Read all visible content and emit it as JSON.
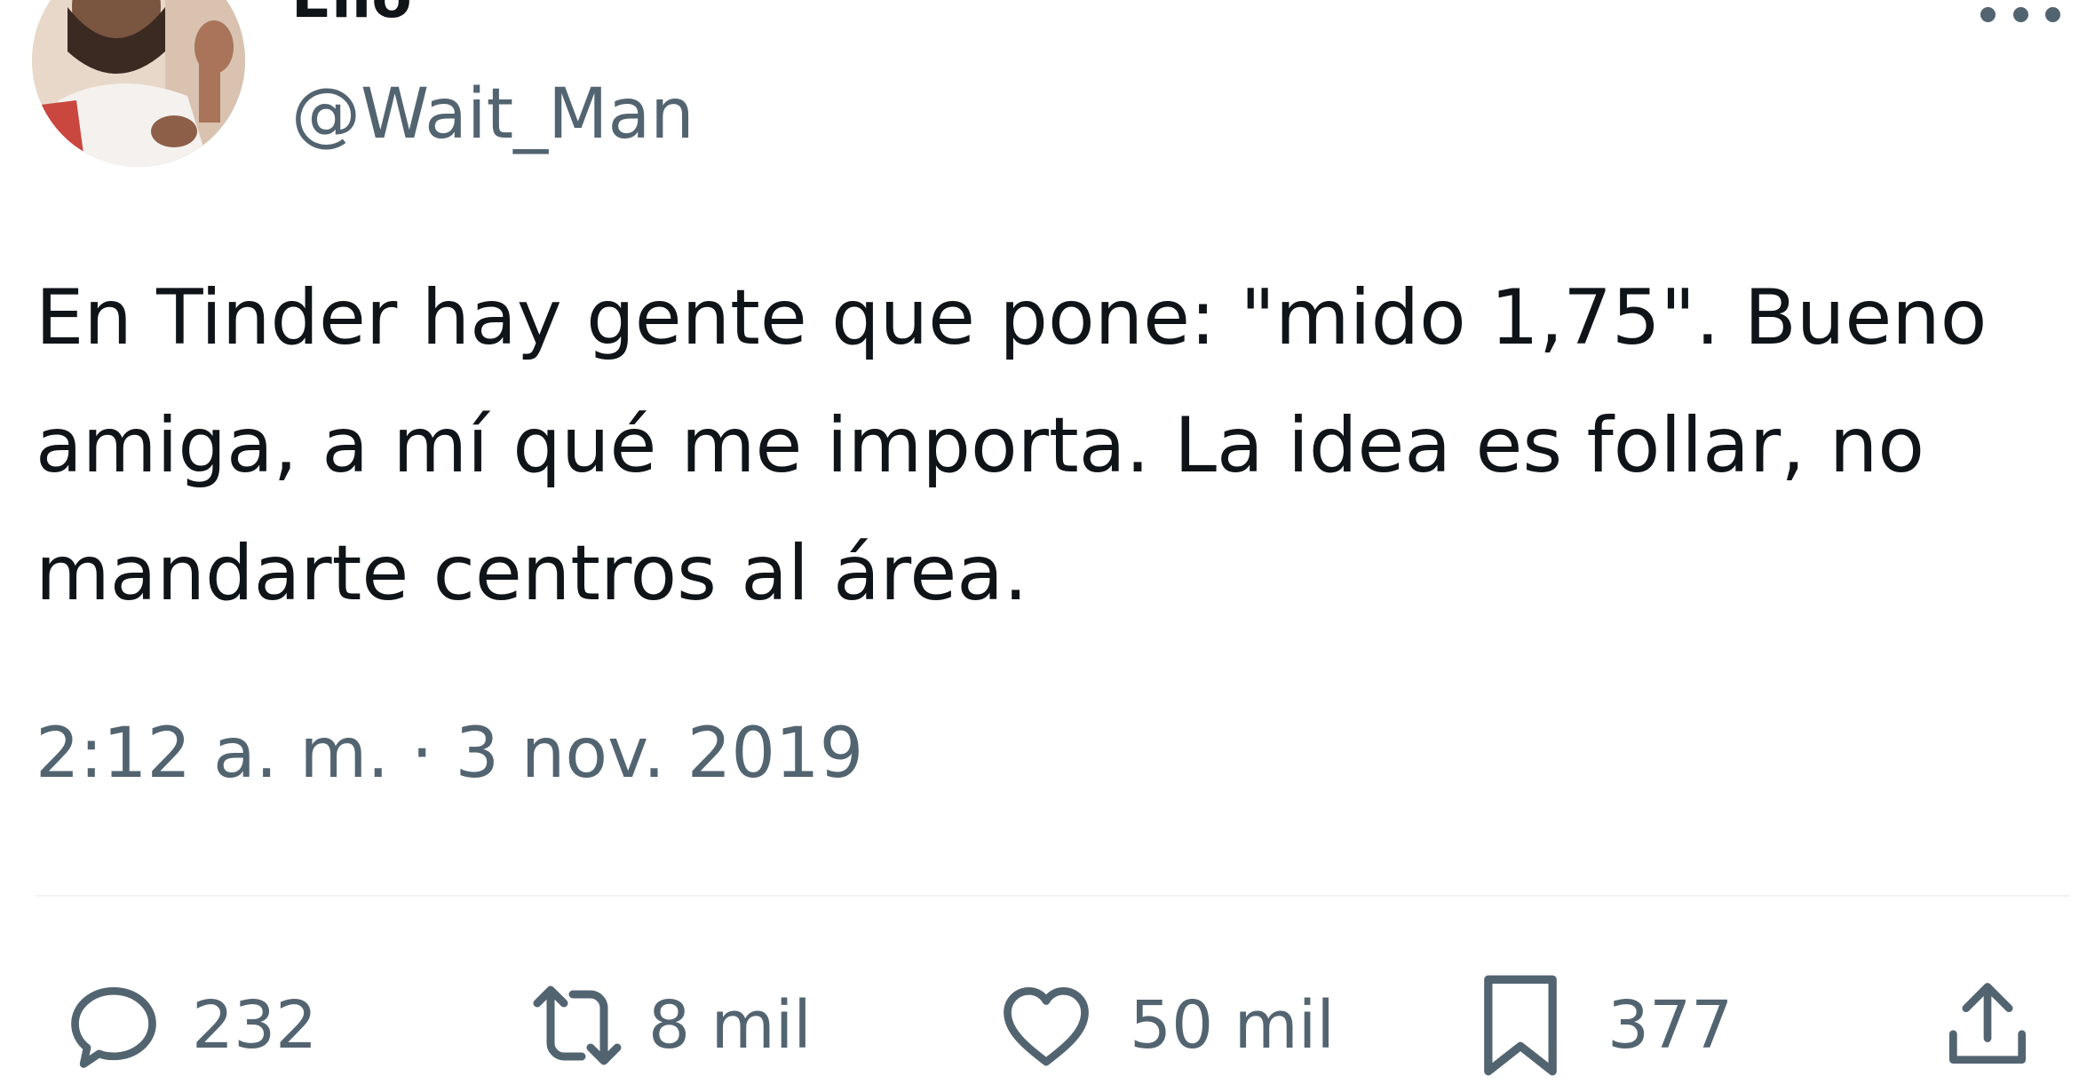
{
  "author": {
    "display_name": "Ello",
    "handle": "@Wait_Man",
    "avatar_icon": "profile-photo"
  },
  "tweet": {
    "text": "En Tinder hay gente que pone: \"mido 1,75\". Bueno amiga, a mí qué me importa. La idea es follar, no mandarte centros al área.",
    "timestamp": "2:12 a. m. · 3 nov. 2019"
  },
  "actions": {
    "reply_count": "232",
    "retweet_count": "8 mil",
    "like_count": "50 mil",
    "bookmark_count": "377",
    "icons": [
      "reply-icon",
      "retweet-icon",
      "like-icon",
      "bookmark-icon",
      "share-icon"
    ]
  },
  "colors": {
    "text_primary": "#0f1419",
    "text_secondary": "#536471",
    "divider": "#eff3f4"
  }
}
